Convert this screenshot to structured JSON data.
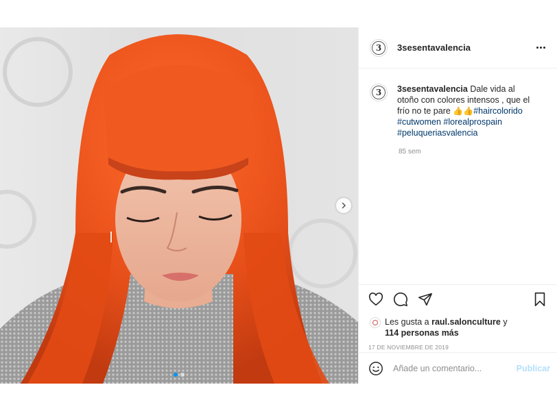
{
  "post": {
    "username": "3sesentavalencia",
    "avatar_glyph": "3",
    "caption": {
      "user": "3sesentavalencia",
      "text": "Dale vida al otoño con colores intensos , que el frío no te pare ",
      "emojis": [
        "👍",
        "👍"
      ],
      "hashtags": [
        "#haircolorido",
        "#cutwomen",
        "#lorealprospain",
        "#peluqueriasvalencia"
      ]
    },
    "time_ago": "85 sem",
    "likes": {
      "prefix": "Les gusta a ",
      "user": "raul.salonculture",
      "connector": " y",
      "others": "114 personas más"
    },
    "date": "17 DE NOVIEMBRE DE 2019",
    "comment": {
      "placeholder": "Añade un comentario...",
      "publish_label": "Publicar"
    }
  },
  "icons": {
    "more": "more-options-icon",
    "like": "heart-icon",
    "comment": "comment-icon",
    "share": "paper-plane-icon",
    "save": "bookmark-icon",
    "emoji": "smiley-icon",
    "next": "chevron-right-icon"
  },
  "colors": {
    "hair": "#e8501a",
    "link": "#00376b",
    "publish": "#b2dffc",
    "muted": "#8e8e8e"
  }
}
